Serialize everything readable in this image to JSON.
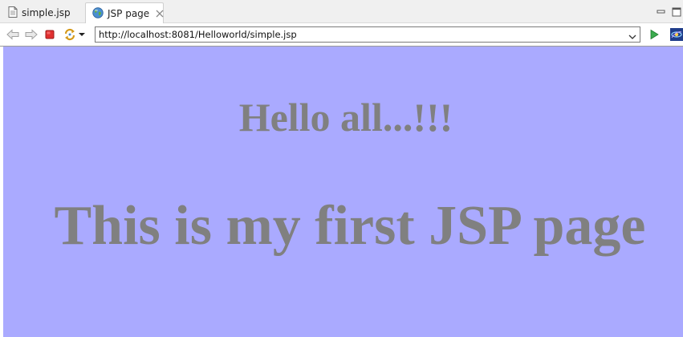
{
  "tabs": [
    {
      "label": "simple.jsp",
      "icon": "jsp-file-icon"
    },
    {
      "label": "JSP page",
      "icon": "globe-icon"
    }
  ],
  "toolbar": {
    "url": "http://localhost:8081/Helloworld/simple.jsp"
  },
  "page": {
    "heading_1": "Hello all...!!!",
    "heading_2": "This is my first JSP page",
    "background_color": "#aaaaff",
    "text_color": "#808080"
  }
}
